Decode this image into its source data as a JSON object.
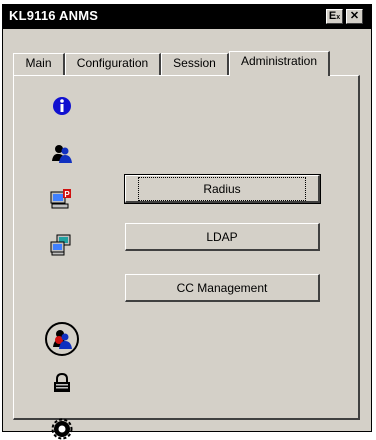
{
  "window": {
    "title": "KL9116 ANMS",
    "ex_button_label": "E",
    "ex_button_sub": "x",
    "close_button_label": "✕"
  },
  "tabs": [
    {
      "label": "Main",
      "active": false
    },
    {
      "label": "Configuration",
      "active": false
    },
    {
      "label": "Session",
      "active": false
    },
    {
      "label": "Administration",
      "active": true
    }
  ],
  "sidebar_icons": [
    {
      "name": "info-icon"
    },
    {
      "name": "user-admin-icon"
    },
    {
      "name": "computer-alert-icon"
    },
    {
      "name": "computer-network-icon"
    },
    {
      "name": "user-account-icon",
      "selected": true
    },
    {
      "name": "lock-icon"
    },
    {
      "name": "settings-gear-icon"
    }
  ],
  "buttons": {
    "radius_label": "Radius",
    "ldap_label": "LDAP",
    "cc_label": "CC Management"
  },
  "colors": {
    "titlebar": "#000000",
    "face": "#d4d0c8",
    "info_blue": "#1010d0",
    "user_red": "#d01010",
    "user_blue": "#1030c0"
  }
}
